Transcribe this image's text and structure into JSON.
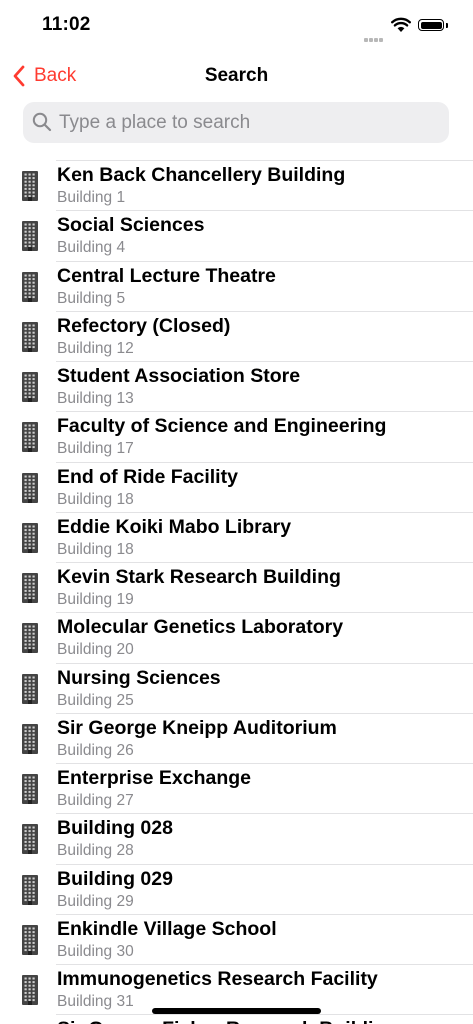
{
  "status_bar": {
    "time": "11:02"
  },
  "nav": {
    "back_label": "Back",
    "title": "Search"
  },
  "search": {
    "placeholder": "Type a place to search"
  },
  "colors": {
    "accent": "#ff3b30",
    "secondary_text": "#8a8a8e",
    "search_bg": "#eeeef0"
  },
  "list_icon": "building-icon",
  "results": [
    {
      "title": "Ken Back Chancellery Building",
      "subtitle": "Building 1"
    },
    {
      "title": "Social Sciences",
      "subtitle": "Building 4"
    },
    {
      "title": "Central Lecture Theatre",
      "subtitle": "Building 5"
    },
    {
      "title": "Refectory (Closed)",
      "subtitle": "Building 12"
    },
    {
      "title": "Student Association Store",
      "subtitle": "Building 13"
    },
    {
      "title": "Faculty of Science and Engineering",
      "subtitle": "Building 17"
    },
    {
      "title": "End of Ride Facility",
      "subtitle": "Building 18"
    },
    {
      "title": "Eddie Koiki Mabo Library",
      "subtitle": "Building 18"
    },
    {
      "title": "Kevin Stark Research Building",
      "subtitle": "Building 19"
    },
    {
      "title": "Molecular Genetics Laboratory",
      "subtitle": "Building 20"
    },
    {
      "title": "Nursing Sciences",
      "subtitle": "Building 25"
    },
    {
      "title": "Sir George Kneipp Auditorium",
      "subtitle": "Building 26"
    },
    {
      "title": "Enterprise Exchange",
      "subtitle": "Building 27"
    },
    {
      "title": "Building 028",
      "subtitle": "Building 28"
    },
    {
      "title": "Building 029",
      "subtitle": "Building 29"
    },
    {
      "title": "Enkindle Village School",
      "subtitle": "Building 30"
    },
    {
      "title": "Immunogenetics Research Facility",
      "subtitle": "Building 31"
    },
    {
      "title": "Sir George Fisher Research Building",
      "subtitle": ""
    }
  ]
}
